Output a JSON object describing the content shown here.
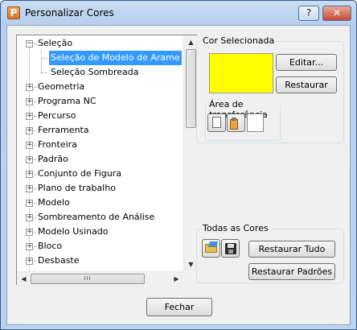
{
  "window": {
    "title": "Personalizar Cores",
    "app_icon_letter": "P",
    "help_label": "?",
    "close_label": "✕"
  },
  "tree": {
    "items": [
      {
        "label": "Seleção",
        "expander": "−"
      },
      {
        "label": "Seleção de Modelo de Arame",
        "selected": true
      },
      {
        "label": "Seleção Sombreada"
      },
      {
        "label": "Geometria",
        "expander": "+"
      },
      {
        "label": "Programa NC",
        "expander": "+"
      },
      {
        "label": "Percurso",
        "expander": "+"
      },
      {
        "label": "Ferramenta",
        "expander": "+"
      },
      {
        "label": "Fronteira",
        "expander": "+"
      },
      {
        "label": "Padrão",
        "expander": "+"
      },
      {
        "label": "Conjunto de Figura",
        "expander": "+"
      },
      {
        "label": "Plano de trabalho",
        "expander": "+"
      },
      {
        "label": "Modelo",
        "expander": "+"
      },
      {
        "label": "Sombreamento de Análise",
        "expander": "+"
      },
      {
        "label": "Modelo Usinado",
        "expander": "+"
      },
      {
        "label": "Bloco",
        "expander": "+"
      },
      {
        "label": "Desbaste",
        "expander": "+"
      }
    ],
    "scroll_up": "▲",
    "scroll_down": "▼",
    "scroll_left": "◀",
    "scroll_right": "▶",
    "thumb_grip": "III"
  },
  "selected_color": {
    "group_label": "Cor Selecionada",
    "swatch_color": "#FFFF00",
    "edit_button": "Editar...",
    "restore_button": "Restaurar",
    "clipboard_label": "Área de transferência"
  },
  "all_colors": {
    "group_label": "Todas as Cores",
    "restore_all_button": "Restaurar Tudo",
    "restore_defaults_button": "Restaurar Padrões"
  },
  "footer": {
    "close_button": "Fechar"
  },
  "colors": {
    "selection_bg": "#3399FF",
    "title_bar": "#C9DCF3",
    "close_button": "#C44A34"
  }
}
